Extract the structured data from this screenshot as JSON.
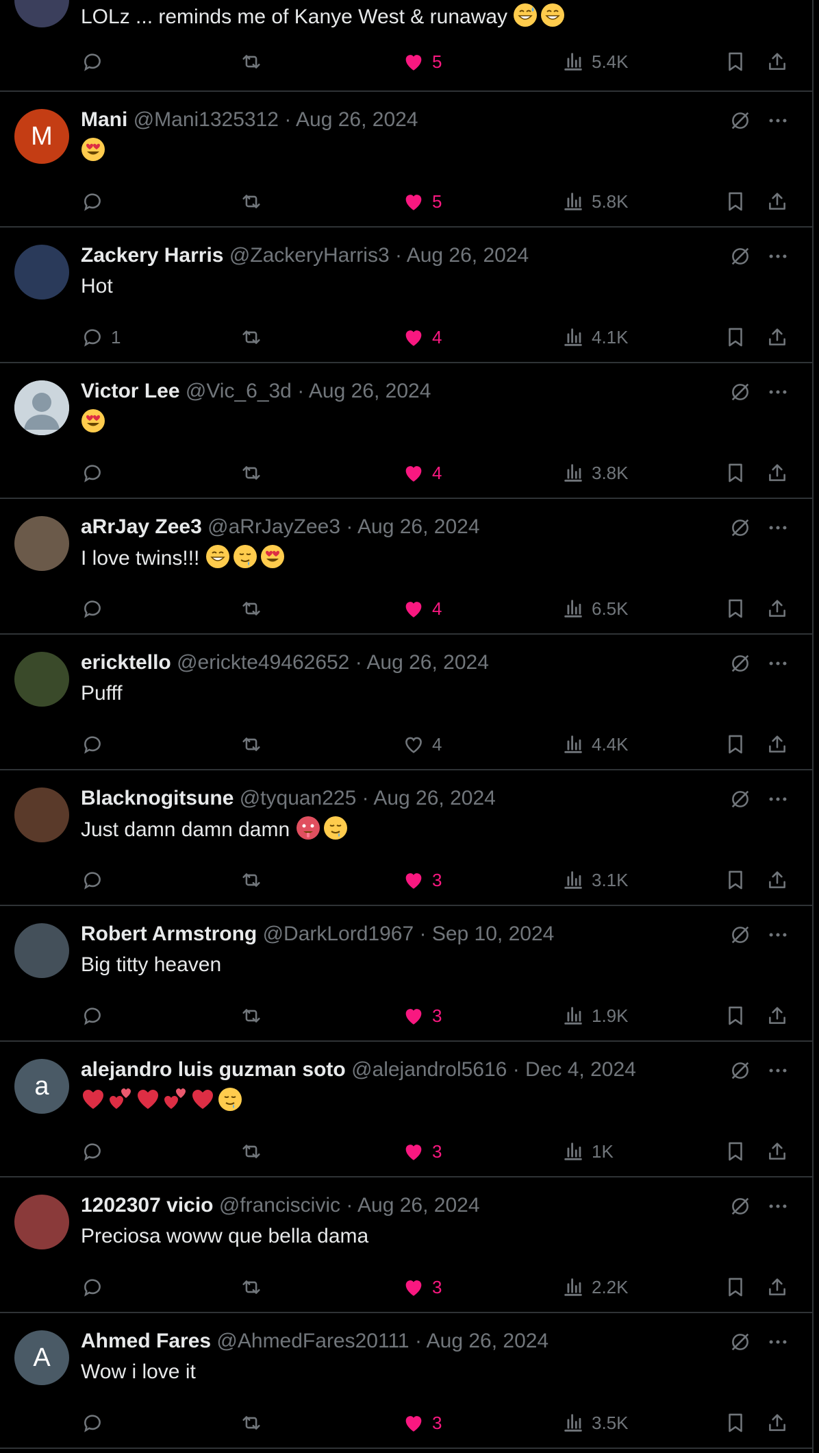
{
  "colors": {
    "background": "#000000",
    "text": "#e7e9ea",
    "muted": "#71767b",
    "like": "#f91880",
    "divider": "#2f3336"
  },
  "partial_top": {
    "text": "LOLz ... reminds me of Kanye West & runaway",
    "emojis": [
      "grinning-sweat-emoji",
      "beaming-grin-emoji"
    ],
    "likes": "5",
    "liked": true,
    "views": "5.4K"
  },
  "tweets": [
    {
      "avatar_letter": "M",
      "avatar_color": "#c43d14",
      "name": "Mani",
      "handle": "@Mani1325312",
      "date": "Aug 26, 2024",
      "text": "",
      "emojis": [
        "heart-eyes-emoji"
      ],
      "replies": "",
      "likes": "5",
      "liked": true,
      "views": "5.8K"
    },
    {
      "avatar_letter": "",
      "avatar_color": "#2a3a5a",
      "name": "Zackery Harris",
      "handle": "@ZackeryHarris3",
      "date": "Aug 26, 2024",
      "text": "Hot",
      "emojis": [],
      "replies": "1",
      "likes": "4",
      "liked": true,
      "views": "4.1K"
    },
    {
      "avatar_letter": "",
      "avatar_color": "#ccd6dd",
      "name": "Victor Lee",
      "handle": "@Vic_6_3d",
      "date": "Aug 26, 2024",
      "text": "",
      "emojis": [
        "heart-eyes-emoji"
      ],
      "replies": "",
      "likes": "4",
      "liked": true,
      "views": "3.8K"
    },
    {
      "avatar_letter": "",
      "avatar_color": "#6b5a4a",
      "name": "aRrJay Zee3",
      "handle": "@aRrJayZee3",
      "date": "Aug 26, 2024",
      "text": "I love twins!!!",
      "emojis": [
        "beaming-grin-emoji",
        "drooling-emoji",
        "heart-eyes-emoji"
      ],
      "replies": "",
      "likes": "4",
      "liked": true,
      "views": "6.5K"
    },
    {
      "avatar_letter": "",
      "avatar_color": "#3a4a2a",
      "name": "ericktello",
      "handle": "@erickte49462652",
      "date": "Aug 26, 2024",
      "text": "Pufff",
      "emojis": [],
      "replies": "",
      "likes": "4",
      "liked": false,
      "views": "4.4K"
    },
    {
      "avatar_letter": "",
      "avatar_color": "#5a3a2a",
      "name": "Blacknogitsune",
      "handle": "@tyquan225",
      "date": "Aug 26, 2024",
      "text": "Just damn damn damn",
      "emojis": [
        "hot-face-emoji",
        "drooling-emoji"
      ],
      "replies": "",
      "likes": "3",
      "liked": true,
      "views": "3.1K"
    },
    {
      "avatar_letter": "",
      "avatar_color": "#44505a",
      "name": "Robert Armstrong",
      "handle": "@DarkLord1967",
      "date": "Sep 10, 2024",
      "text": "Big titty heaven",
      "emojis": [],
      "replies": "",
      "likes": "3",
      "liked": true,
      "views": "1.9K"
    },
    {
      "avatar_letter": "a",
      "avatar_color": "#4a5a66",
      "name": "alejandro luis guzman soto",
      "handle": "@alejandrol5616",
      "date": "Dec 4, 2024",
      "text": "",
      "emojis": [
        "red-heart-emoji",
        "two-hearts-emoji",
        "red-heart-emoji",
        "two-hearts-emoji",
        "red-heart-emoji",
        "drooling-emoji"
      ],
      "replies": "",
      "likes": "3",
      "liked": true,
      "views": "1K"
    },
    {
      "avatar_letter": "",
      "avatar_color": "#8a3a3a",
      "name": "1202307 vicio",
      "handle": "@franciscivic",
      "date": "Aug 26, 2024",
      "text": "Preciosa woww que bella dama",
      "emojis": [],
      "replies": "",
      "likes": "3",
      "liked": true,
      "views": "2.2K"
    },
    {
      "avatar_letter": "A",
      "avatar_color": "#4a5a66",
      "name": "Ahmed Fares",
      "handle": "@AhmedFares20111",
      "date": "Aug 26, 2024",
      "text": "Wow i love it",
      "emojis": [],
      "replies": "",
      "likes": "3",
      "liked": true,
      "views": "3.5K"
    }
  ]
}
